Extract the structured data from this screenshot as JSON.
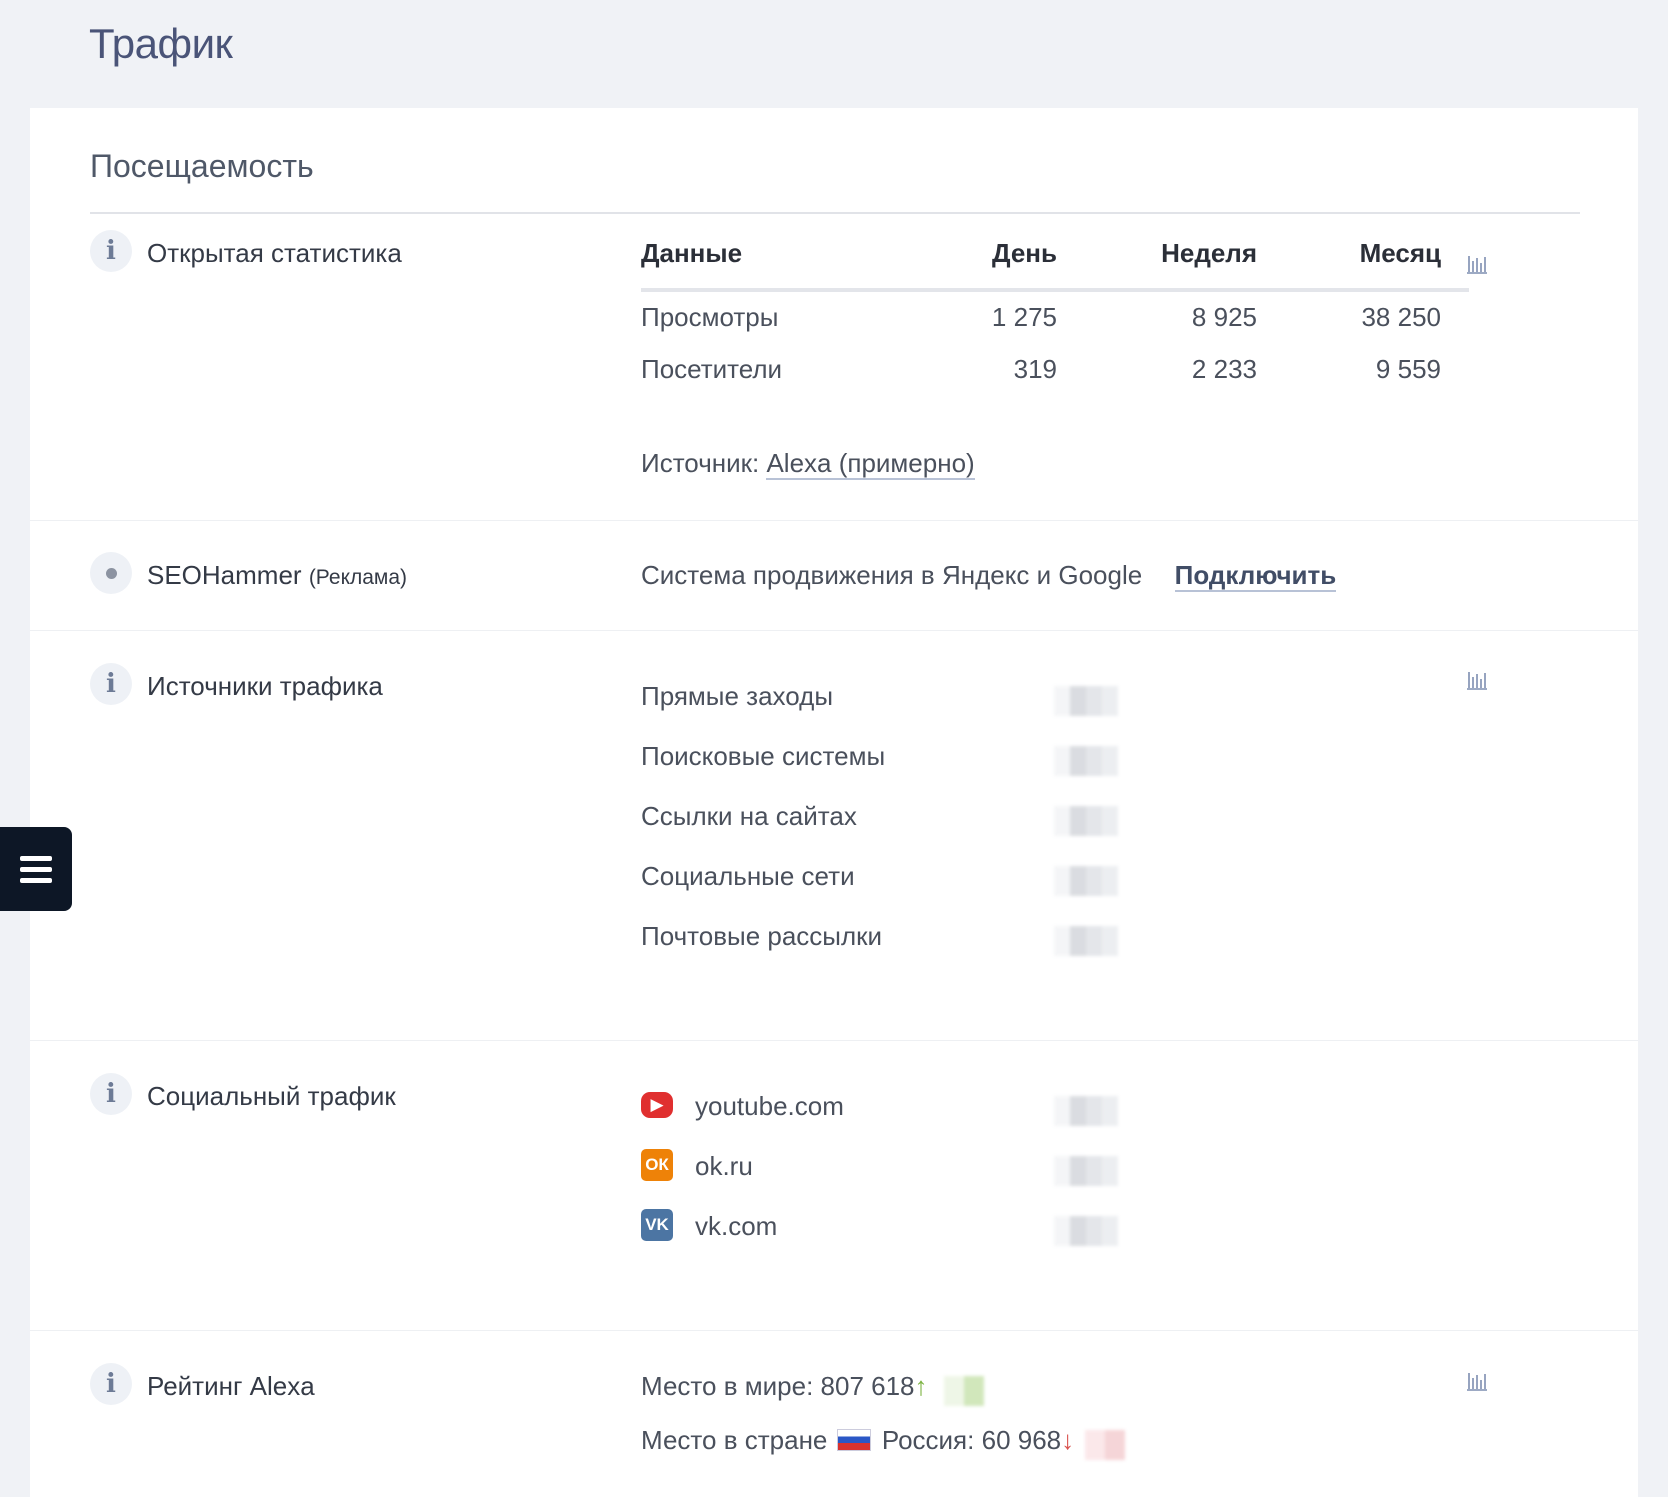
{
  "page": {
    "title": "Трафик"
  },
  "attendance": {
    "title": "Посещаемость",
    "open_stats": {
      "label": "Открытая статистика",
      "headers": [
        "Данные",
        "День",
        "Неделя",
        "Месяц"
      ],
      "rows": [
        {
          "name": "Просмотры",
          "day": "1 275",
          "week": "8 925",
          "month": "38 250"
        },
        {
          "name": "Посетители",
          "day": "319",
          "week": "2 233",
          "month": "9 559"
        }
      ],
      "source_prefix": "Источник:",
      "source_link": "Alexa (примерно)"
    },
    "ad": {
      "label": "SEOHammer",
      "label_suffix": "(Реклама)",
      "text": "Система продвижения в Яндекс и Google",
      "button": "Подключить"
    },
    "traffic_sources": {
      "label": "Источники трафика",
      "items": [
        "Прямые заходы",
        "Поисковые системы",
        "Ссылки на сайтах",
        "Социальные сети",
        "Почтовые рассылки"
      ]
    },
    "social_traffic": {
      "label": "Социальный трафик",
      "items": [
        {
          "domain": "youtube.com",
          "icon": "youtube-icon",
          "color": "#e02f2f"
        },
        {
          "domain": "ok.ru",
          "icon": "odnoklassniki-icon",
          "color": "#ee8208"
        },
        {
          "domain": "vk.com",
          "icon": "vk-icon",
          "color": "#4c75a3"
        }
      ]
    },
    "alexa_rating": {
      "label": "Рейтинг Alexa",
      "world_prefix": "Место в мире:",
      "world_value": "807 618",
      "world_trend": "up",
      "country_prefix": "Место в стране",
      "country_name": "Россия:",
      "country_value": "60 968",
      "country_trend": "down"
    }
  },
  "colors": {
    "accent": "#4a5478",
    "up": "#7cb342",
    "down": "#d9534f"
  }
}
